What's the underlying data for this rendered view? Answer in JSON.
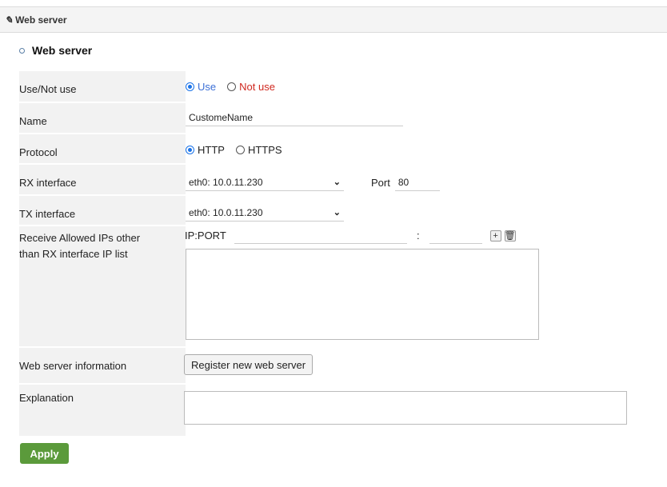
{
  "header": {
    "title": "Web server",
    "icon": "pencil-icon"
  },
  "section": {
    "title": "Web server"
  },
  "labels": {
    "use": "Use/Not use",
    "name": "Name",
    "protocol": "Protocol",
    "rx": "RX interface",
    "tx": "TX interface",
    "allowed_line1": "Receive Allowed IPs other",
    "allowed_line2": "than RX interface IP list",
    "info": "Web server information",
    "explanation": "Explanation"
  },
  "use_options": {
    "use": "Use",
    "not_use": "Not use",
    "selected": "Use"
  },
  "name_value": "CustomeName",
  "protocol_options": {
    "http": "HTTP",
    "https": "HTTPS",
    "selected": "HTTP"
  },
  "rx": {
    "interface": "eth0: 10.0.11.230",
    "port_label": "Port",
    "port_value": "80"
  },
  "tx": {
    "interface": "eth0: 10.0.11.230"
  },
  "allowed": {
    "ip_port_label": "IP:PORT",
    "separator": ":",
    "add": "+",
    "delete_icon": "trash-icon"
  },
  "register_button": "Register new web server",
  "apply_button": "Apply",
  "colors": {
    "apply": "#5b9a3b",
    "use_text": "#3b6fd6",
    "not_use_text": "#d0281f"
  }
}
